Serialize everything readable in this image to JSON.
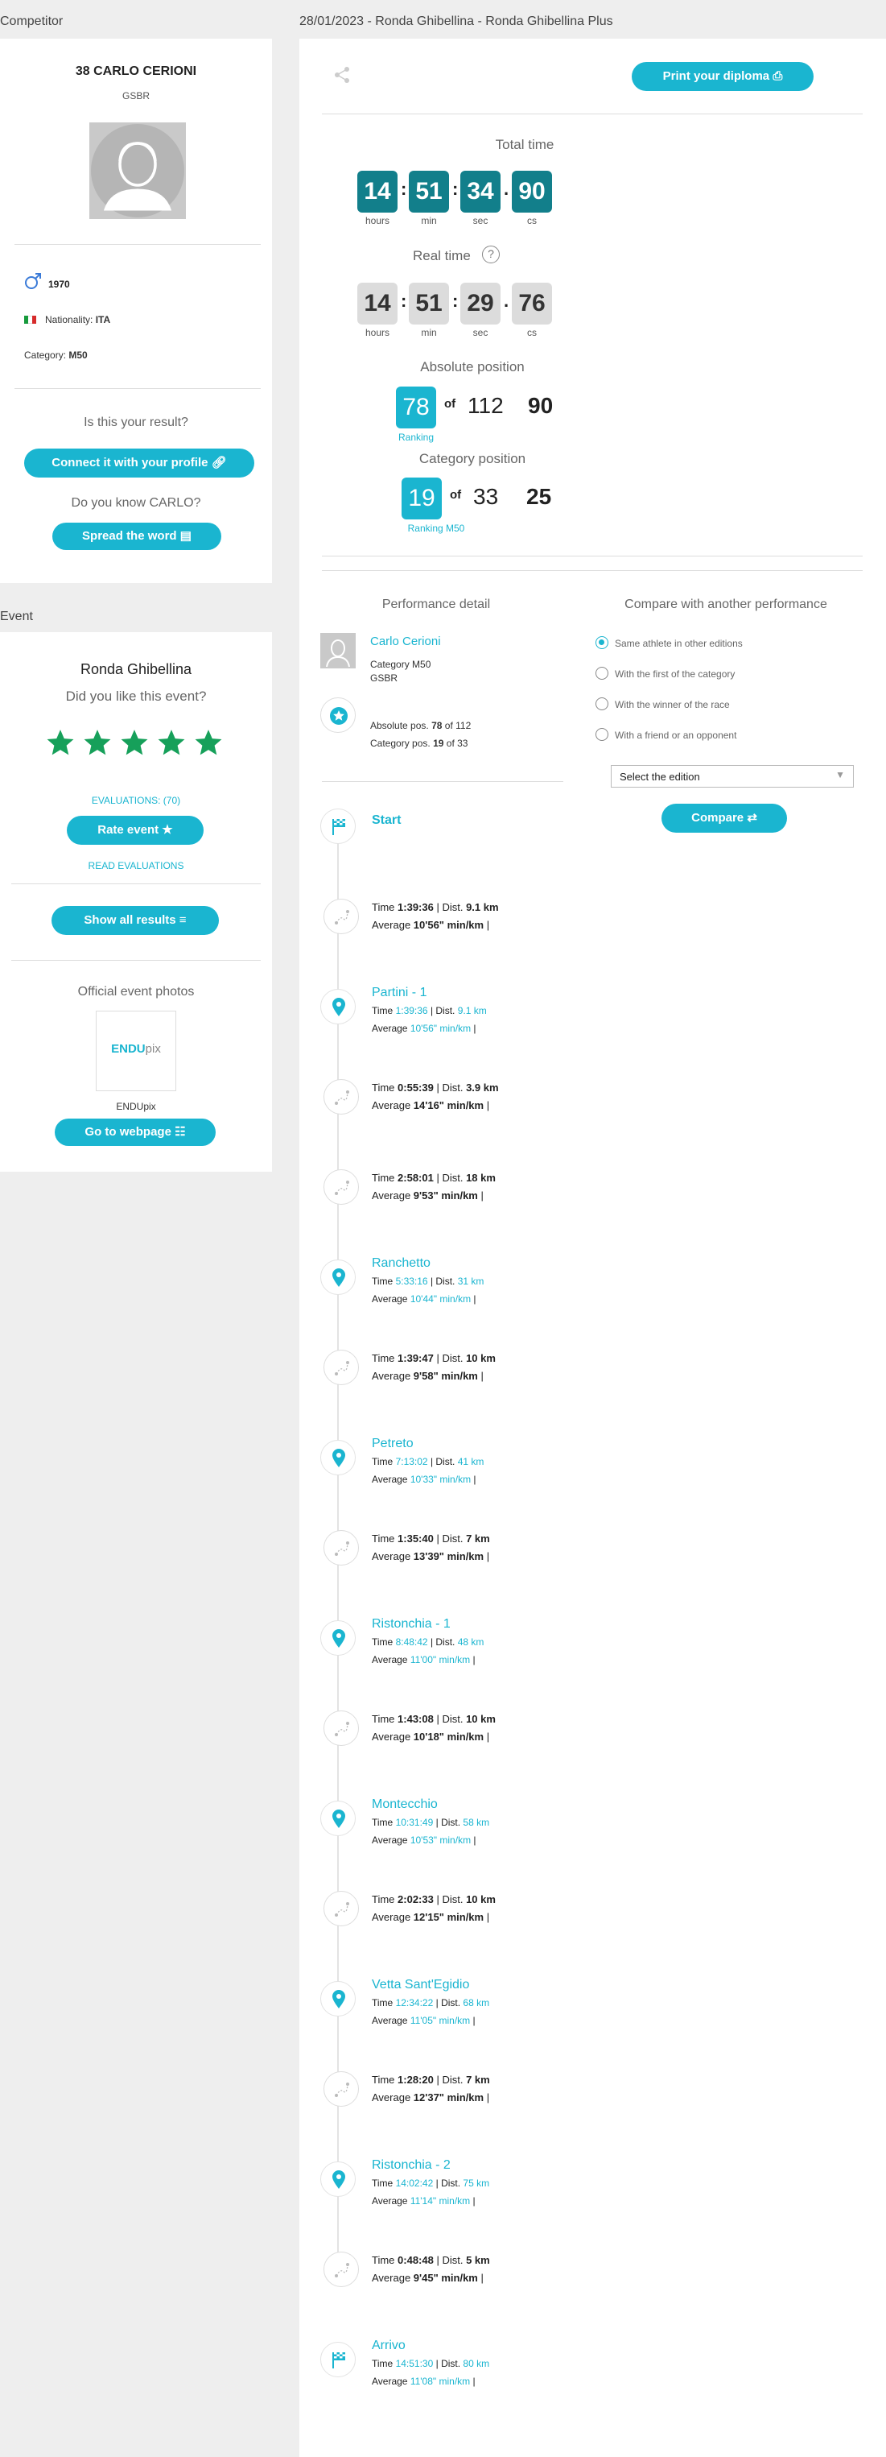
{
  "colors": {
    "accent": "#1ab5d0",
    "dark_teal": "#127f8b",
    "star_green": "#16a05a"
  },
  "sections": {
    "competitor": "Competitor",
    "event_header": "28/01/2023 - Ronda Ghibellina - Ronda Ghibellina Plus",
    "event": "Event"
  },
  "athlete": {
    "name": "38 CARLO CERIONI",
    "team": "GSBR",
    "birth_year": "1970",
    "nationality_label": "Nationality:",
    "nationality": "ITA",
    "category_label": "Category:",
    "category": "M50",
    "is_result": "Is this your result?",
    "connect_btn": "Connect it with your profile",
    "know_q": "Do you know CARLO?",
    "spread_btn": "Spread the word"
  },
  "event_card": {
    "name": "Ronda Ghibellina",
    "like_q": "Did you like this event?",
    "evaluations": "EVALUATIONS: (70)",
    "rate_btn": "Rate event",
    "read_eval": "READ EVALUATIONS",
    "show_results_btn": "Show all results",
    "photos_title": "Official event photos",
    "photo_brand_a": "ENDU",
    "photo_brand_b": "pix",
    "photo_caption": "ENDUpix",
    "go_btn": "Go to webpage",
    "rating": 5
  },
  "result": {
    "print_btn": "Print your diploma",
    "total_title": "Total time",
    "total": [
      "14",
      "51",
      "34",
      "90"
    ],
    "real_title": "Real time",
    "real": [
      "14",
      "51",
      "29",
      "76"
    ],
    "units": [
      "hours",
      "min",
      "sec",
      "cs"
    ],
    "abs_title": "Absolute position",
    "abs_pos": "78",
    "of": "of",
    "abs_total": "112",
    "abs_extra": "90",
    "abs_sub": "Ranking",
    "cat_title": "Category position",
    "cat_pos": "19",
    "cat_total": "33",
    "cat_extra": "25",
    "cat_sub": "Ranking M50"
  },
  "performance": {
    "title": "Performance detail",
    "athlete_name": "Carlo Cerioni",
    "category_line": "Category M50",
    "team": "GSBR",
    "abs_label": "Absolute pos.",
    "abs_val": "78",
    "abs_of": "of 112",
    "cat_label": "Category pos.",
    "cat_val": "19",
    "cat_of": "of 33"
  },
  "compare": {
    "title": "Compare with another performance",
    "options": [
      "Same athlete in other editions",
      "With the first of the category",
      "With the winner of the race",
      "With a friend or an opponent"
    ],
    "selected_index": 0,
    "select_placeholder": "Select the edition",
    "compare_btn": "Compare"
  },
  "timeline": {
    "time_label": "Time",
    "dist_label": "Dist.",
    "avg_label": "Average",
    "start": "Start",
    "segments": [
      {
        "time": "1:39:36",
        "dist": "9.1 km",
        "avg": "10'56\" min/km"
      },
      {
        "time": "0:55:39",
        "dist": "3.9 km",
        "avg": "14'16\" min/km"
      },
      {
        "time": "2:58:01",
        "dist": "18 km",
        "avg": "9'53\" min/km"
      },
      {
        "time": "1:39:47",
        "dist": "10 km",
        "avg": "9'58\" min/km"
      },
      {
        "time": "1:35:40",
        "dist": "7 km",
        "avg": "13'39\" min/km"
      },
      {
        "time": "1:43:08",
        "dist": "10 km",
        "avg": "10'18\" min/km"
      },
      {
        "time": "2:02:33",
        "dist": "10 km",
        "avg": "12'15\" min/km"
      },
      {
        "time": "1:28:20",
        "dist": "7 km",
        "avg": "12'37\" min/km"
      },
      {
        "time": "0:48:48",
        "dist": "5 km",
        "avg": "9'45\" min/km"
      }
    ],
    "checkpoints": [
      {
        "name": "Partini - 1",
        "time": "1:39:36",
        "dist": "9.1 km",
        "avg": "10'56\" min/km"
      },
      {
        "name": "Ranchetto",
        "time": "5:33:16",
        "dist": "31 km",
        "avg": "10'44\" min/km"
      },
      {
        "name": "Petreto",
        "time": "7:13:02",
        "dist": "41 km",
        "avg": "10'33\" min/km"
      },
      {
        "name": "Ristonchia - 1",
        "time": "8:48:42",
        "dist": "48 km",
        "avg": "11'00\" min/km"
      },
      {
        "name": "Montecchio",
        "time": "10:31:49",
        "dist": "58 km",
        "avg": "10'53\" min/km"
      },
      {
        "name": "Vetta Sant'Egidio",
        "time": "12:34:22",
        "dist": "68 km",
        "avg": "11'05\" min/km"
      },
      {
        "name": "Ristonchia - 2",
        "time": "14:02:42",
        "dist": "75 km",
        "avg": "11'14\" min/km"
      }
    ],
    "finish": {
      "name": "Arrivo",
      "time": "14:51:30",
      "dist": "80 km",
      "avg": "11'08\" min/km"
    }
  }
}
